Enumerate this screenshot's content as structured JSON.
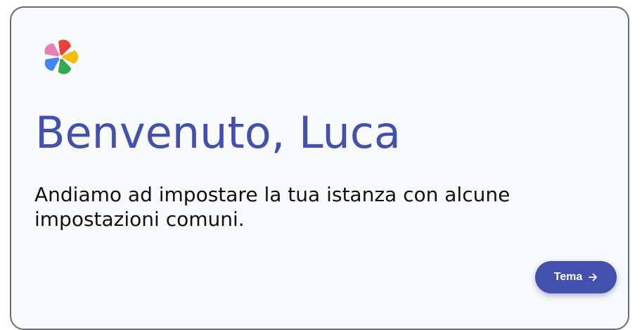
{
  "welcome": {
    "title": "Benvenuto, Luca",
    "subtitle": "Andiamo ad impostare la tua istanza con alcune impostazioni comuni.",
    "next_button_label": "Tema"
  },
  "icons": {
    "logo": "pinwheel-logo-icon",
    "next": "arrow-right-icon"
  },
  "colors": {
    "accent": "#4350ad",
    "card_background": "#f8f9fb",
    "logo_petals": [
      "#ea4335",
      "#fbbc04",
      "#34a853",
      "#4285f4",
      "#e87fb3"
    ]
  }
}
